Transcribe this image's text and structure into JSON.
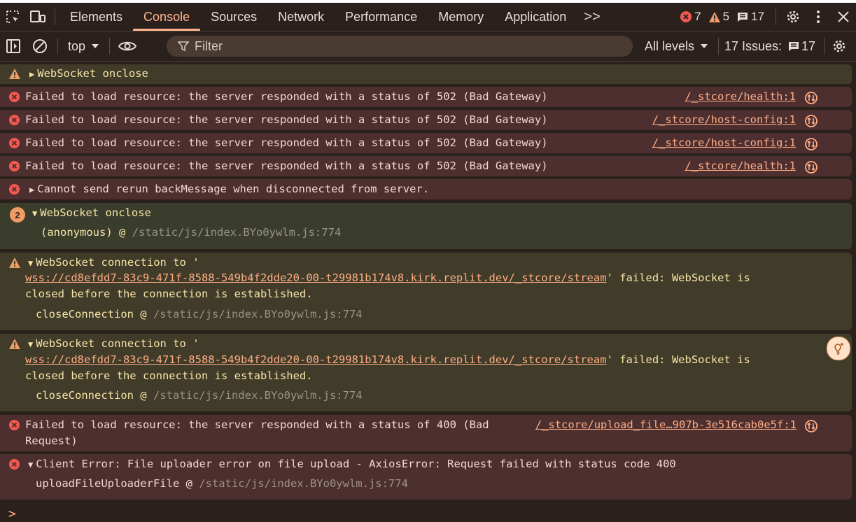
{
  "tabs": [
    {
      "label": "Elements",
      "active": false
    },
    {
      "label": "Console",
      "active": true
    },
    {
      "label": "Sources",
      "active": false
    },
    {
      "label": "Network",
      "active": false
    },
    {
      "label": "Performance",
      "active": false
    },
    {
      "label": "Memory",
      "active": false
    },
    {
      "label": "Application",
      "active": false
    }
  ],
  "more_tabs": ">>",
  "counters": {
    "errors": "7",
    "warnings": "5",
    "issues": "17"
  },
  "toolbar": {
    "context": "top",
    "filter_placeholder": "Filter",
    "levels": "All levels",
    "issues_label": "17 Issues:",
    "issues_count": "17"
  },
  "messages": [
    {
      "text": "WebSocket onclose"
    },
    {
      "text": "Failed to load resource: the server responded with a status of 502 (Bad Gateway)",
      "source": "/_stcore/health:1"
    },
    {
      "text": "Failed to load resource: the server responded with a status of 502 (Bad Gateway)",
      "source": "/_stcore/host-config:1"
    },
    {
      "text": "Failed to load resource: the server responded with a status of 502 (Bad Gateway)",
      "source": "/_stcore/host-config:1"
    },
    {
      "text": "Failed to load resource: the server responded with a status of 502 (Bad Gateway)",
      "source": "/_stcore/health:1"
    },
    {
      "text": "Cannot send rerun backMessage when disconnected from server."
    },
    {
      "count": "2",
      "text": "WebSocket onclose",
      "stack_fn": "(anonymous) @",
      "stack_src": "/static/js/index.BYo0ywlm.js:774"
    },
    {
      "prefix": "WebSocket connection to '",
      "url": "wss://cd8efdd7-83c9-471f-8588-549b4f2dde20-00-t29981b174v8.kirk.replit.dev/_stcore/stream",
      "suffix": "' failed: WebSocket is",
      "line3": "closed before the connection is established.",
      "stack_fn": "closeConnection @",
      "stack_src": "/static/js/index.BYo0ywlm.js:774"
    },
    {
      "prefix": "WebSocket connection to '",
      "url": "wss://cd8efdd7-83c9-471f-8588-549b4f2dde20-00-t29981b174v8.kirk.replit.dev/_stcore/stream",
      "suffix": "' failed: WebSocket is",
      "line3": "closed before the connection is established.",
      "stack_fn": "closeConnection @",
      "stack_src": "/static/js/index.BYo0ywlm.js:774"
    },
    {
      "text": "Failed to load resource: the server responded with a status of 400 (Bad",
      "text2": "Request)",
      "source": "/_stcore/upload_file…907b-3e516cab0e5f:1"
    },
    {
      "text": "Client Error: File uploader error on file upload - AxiosError: Request failed with status code 400",
      "stack_fn": "uploadFileUploaderFile @",
      "stack_src": "/static/js/index.BYo0ywlm.js:774"
    }
  ],
  "prompt": ">",
  "colors": {
    "bg": "#2b211c",
    "accent": "#ffb48f",
    "error": "#f0594f",
    "warning": "#f09c66"
  }
}
